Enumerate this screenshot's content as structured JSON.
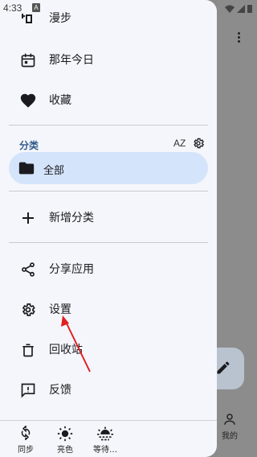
{
  "status": {
    "time": "4:33",
    "notif_icon": "A"
  },
  "drawer": {
    "top_items": [
      {
        "label": "漫步",
        "icon": "shuffle-icon"
      },
      {
        "label": "那年今日",
        "icon": "calendar-icon"
      },
      {
        "label": "收藏",
        "icon": "heart-icon"
      }
    ],
    "section": {
      "title": "分类",
      "sort_label": "AZ"
    },
    "category_selected": {
      "label": "全部",
      "icon": "folder-icon"
    },
    "add_category": {
      "label": "新增分类",
      "icon": "plus-icon"
    },
    "menu": [
      {
        "label": "分享应用",
        "icon": "share-icon"
      },
      {
        "label": "设置",
        "icon": "gear-icon"
      },
      {
        "label": "回收站",
        "icon": "trash-icon"
      },
      {
        "label": "反馈",
        "icon": "feedback-icon"
      }
    ],
    "bottom": [
      {
        "label": "同步",
        "icon": "sync-icon"
      },
      {
        "label": "亮色",
        "icon": "sun-icon"
      },
      {
        "label": "等待…",
        "icon": "weather-icon"
      }
    ]
  },
  "background": {
    "tab_label": "我的"
  },
  "colors": {
    "drawer_bg": "#f5f6fb",
    "selected_bg": "#d4e4fb",
    "section_title": "#2f5a8a",
    "annotation_arrow": "#e02020"
  }
}
